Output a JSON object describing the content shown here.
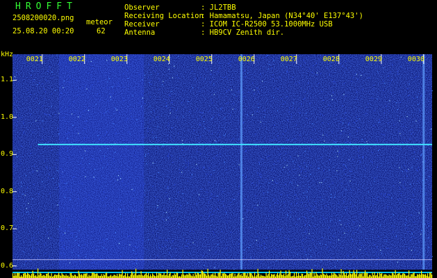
{
  "header": {
    "app_title": "HROFFT",
    "file_name": "2508200020.png",
    "date_time": "25.08.20 00:20",
    "meteor_label": "meteor",
    "meteor_count": "62",
    "fields": [
      {
        "label": "Observer",
        "value": ": JL2TBB"
      },
      {
        "label": "Receiving Location",
        "value": ": Hamamatsu, Japan (N34°40' E137°43')"
      },
      {
        "label": "Receiver",
        "value": ": ICOM IC-R2500 53.1000MHz USB"
      },
      {
        "label": "Antenna",
        "value": ": HB9CV Zenith dir."
      }
    ]
  },
  "colors": {
    "text": "#ffff00",
    "title": "#33ff33",
    "background": "#000000",
    "noise": "#1428a0",
    "carrier": "#40e0ff",
    "level_bars": "#ffff00",
    "level_baseline": "#00c8ff"
  },
  "chart_data": {
    "type": "heatmap",
    "title": "",
    "xlabel": "",
    "ylabel": "kHz",
    "x_ticks": [
      "0021",
      "0022",
      "0023",
      "0024",
      "0025",
      "0026",
      "0027",
      "0028",
      "0029",
      "0030"
    ],
    "x_range_minutes": [
      20.3,
      30.2
    ],
    "y_ticks": [
      1.1,
      1.0,
      0.9,
      0.8,
      0.7,
      0.6
    ],
    "ylim": [
      0.59,
      1.17
    ],
    "carrier_line": {
      "frequency_khz": 0.927,
      "x_start_minute": 20.9,
      "x_end_minute": 30.2
    },
    "bright_vertical_traces_minute": [
      25.7,
      30.0
    ],
    "brighter_band_minutes": [
      21.4,
      23.4
    ],
    "reference_line_khz": 0.617
  }
}
